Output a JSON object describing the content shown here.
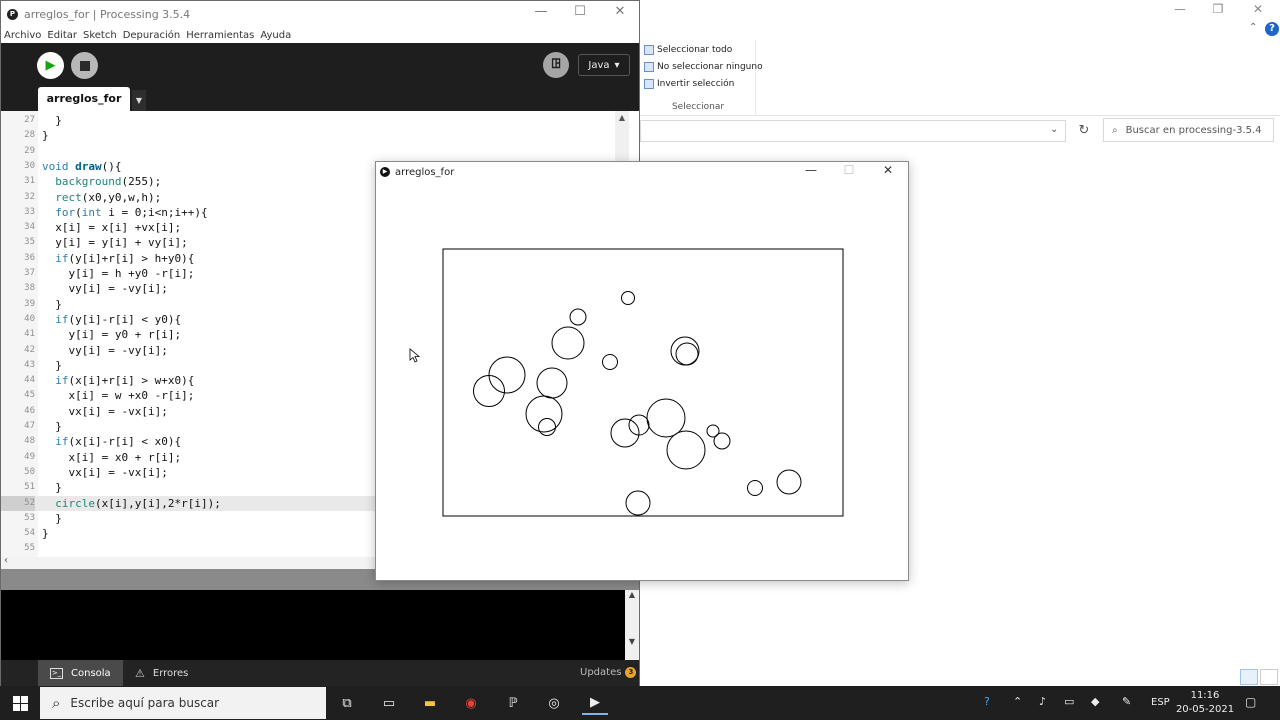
{
  "explorer": {
    "ribbon_items": [
      {
        "label": "Seleccionar todo",
        "icon": "select-all-icon"
      },
      {
        "label": "No seleccionar ninguno",
        "icon": "select-none-icon"
      },
      {
        "label": "Invertir selección",
        "icon": "invert-selection-icon"
      }
    ],
    "ribbon_group_label": "Seleccionar",
    "search_placeholder": "Buscar en processing-3.5.4"
  },
  "ide": {
    "window_title": "arreglos_for | Processing 3.5.4",
    "menu": [
      "Archivo",
      "Editar",
      "Sketch",
      "Depuración",
      "Herramientas",
      "Ayuda"
    ],
    "mode_label": "Java",
    "tab_name": "arreglos_for",
    "code_lines": [
      {
        "n": "27",
        "text": "  }"
      },
      {
        "n": "28",
        "text": "}"
      },
      {
        "n": "29",
        "text": ""
      },
      {
        "n": "30",
        "text": "void draw(){"
      },
      {
        "n": "31",
        "text": "  background(255);"
      },
      {
        "n": "32",
        "text": "  rect(x0,y0,w,h);"
      },
      {
        "n": "33",
        "text": "  for(int i = 0;i<n;i++){"
      },
      {
        "n": "34",
        "text": "  x[i] = x[i] +vx[i];"
      },
      {
        "n": "35",
        "text": "  y[i] = y[i] + vy[i];"
      },
      {
        "n": "36",
        "text": "  if(y[i]+r[i] > h+y0){"
      },
      {
        "n": "37",
        "text": "    y[i] = h +y0 -r[i];"
      },
      {
        "n": "38",
        "text": "    vy[i] = -vy[i];"
      },
      {
        "n": "39",
        "text": "  }"
      },
      {
        "n": "40",
        "text": "  if(y[i]-r[i] < y0){"
      },
      {
        "n": "41",
        "text": "    y[i] = y0 + r[i];"
      },
      {
        "n": "42",
        "text": "    vy[i] = -vy[i];"
      },
      {
        "n": "43",
        "text": "  }"
      },
      {
        "n": "44",
        "text": "  if(x[i]+r[i] > w+x0){"
      },
      {
        "n": "45",
        "text": "    x[i] = w +x0 -r[i];"
      },
      {
        "n": "46",
        "text": "    vx[i] = -vx[i];"
      },
      {
        "n": "47",
        "text": "  }"
      },
      {
        "n": "48",
        "text": "  if(x[i]-r[i] < x0){"
      },
      {
        "n": "49",
        "text": "    x[i] = x0 + r[i];"
      },
      {
        "n": "50",
        "text": "    vx[i] = -vx[i];"
      },
      {
        "n": "51",
        "text": "  }"
      },
      {
        "n": "52",
        "text": "  circle(x[i],y[i],2*r[i]);"
      },
      {
        "n": "53",
        "text": "  }"
      },
      {
        "n": "54",
        "text": "}"
      },
      {
        "n": "55",
        "text": ""
      }
    ],
    "current_line": "52",
    "console_tab": "Consola",
    "errors_tab": "Errores",
    "updates_label": "Updates",
    "updates_count": "3"
  },
  "sketch": {
    "window_title": "arreglos_for"
  },
  "taskbar": {
    "search_placeholder": "Escribe aquí para buscar",
    "language": "ESP",
    "time": "11:16",
    "date": "20-05-2021"
  },
  "colors": {
    "run_green": "#12a512",
    "taskbar_bg": "#1f1f1f",
    "ide_dark": "#1e1e1e",
    "badge_orange": "#e8a52a"
  }
}
